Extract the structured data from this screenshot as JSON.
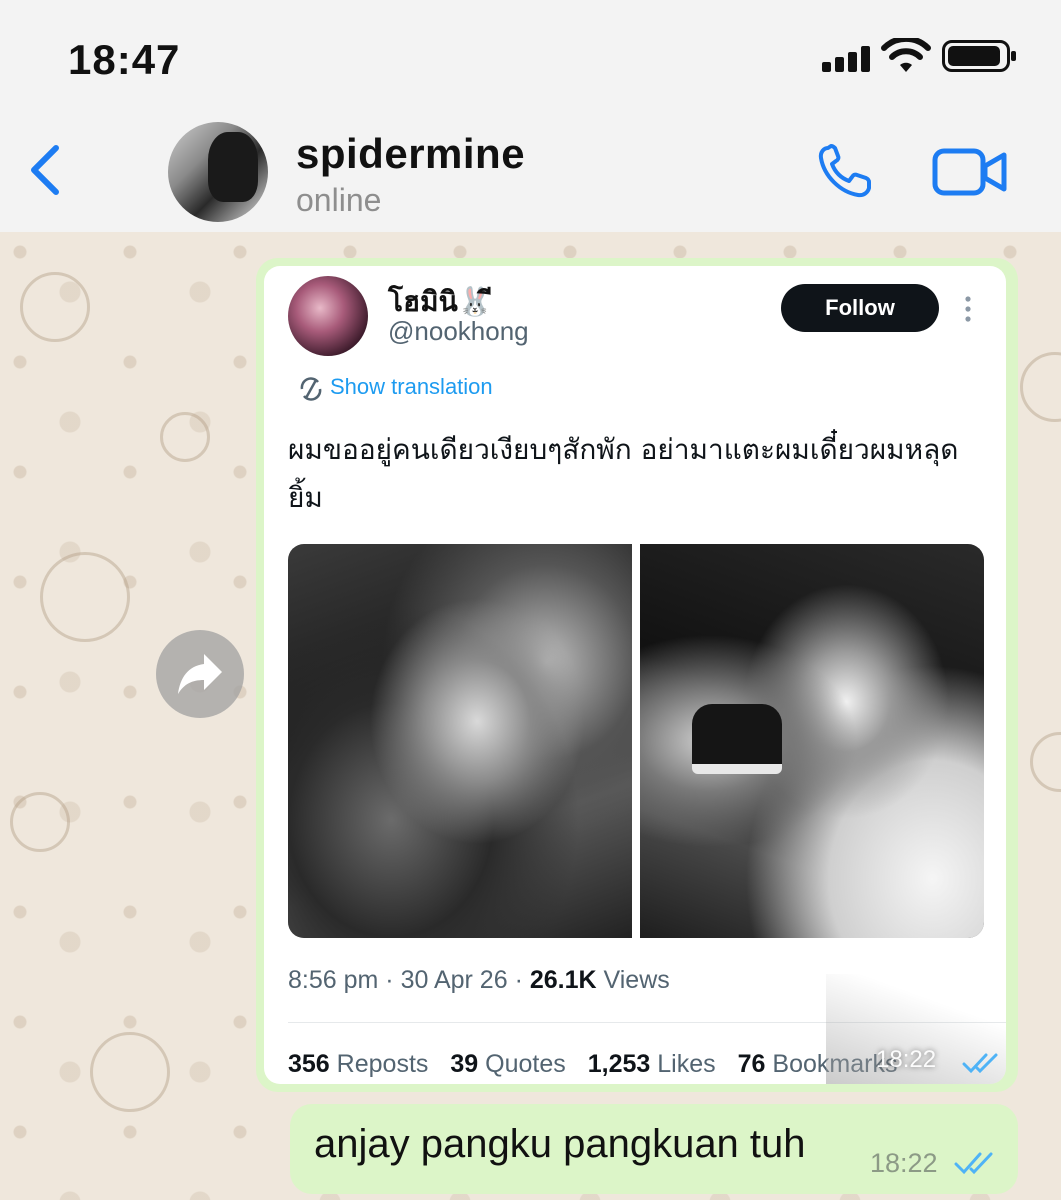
{
  "status_bar": {
    "time": "18:47"
  },
  "header": {
    "contact_name": "spidermine",
    "contact_status": "online"
  },
  "tweet": {
    "display_name": "โฮมินิ🐰ี",
    "handle": "@nookhong",
    "follow_label": "Follow",
    "show_translation": "Show translation",
    "text": "ผมขออยู่คนเดียวเงียบๆสักพัก อย่ามาแตะผมเดี๋ยวผมหลุดยิ้ม",
    "time": "8:56 pm",
    "date": "30 Apr 26",
    "views_count": "26.1K",
    "views_label": "Views",
    "reposts_count": "356",
    "reposts_label": "Reposts",
    "quotes_count": "39",
    "quotes_label": "Quotes",
    "likes_count": "1,253",
    "likes_label": "Likes",
    "bookmarks_count": "76",
    "bookmarks_label": "Bookmarks"
  },
  "messages": [
    {
      "type": "tweet-share",
      "time": "18:22",
      "status": "read"
    },
    {
      "type": "text",
      "text": "anjay pangku pangkuan tuh",
      "time": "18:22",
      "status": "read"
    }
  ],
  "colors": {
    "outgoing_bubble": "#dcf5c8",
    "accent_blue": "#1d7cf2",
    "twitter_blue": "#1d9bf0",
    "read_check": "#4fb3f6",
    "wallpaper": "#efe7dc"
  },
  "icons": [
    "back-chevron-icon",
    "phone-icon",
    "video-camera-icon",
    "forward-icon",
    "translate-icon",
    "more-icon",
    "double-check-icon"
  ]
}
